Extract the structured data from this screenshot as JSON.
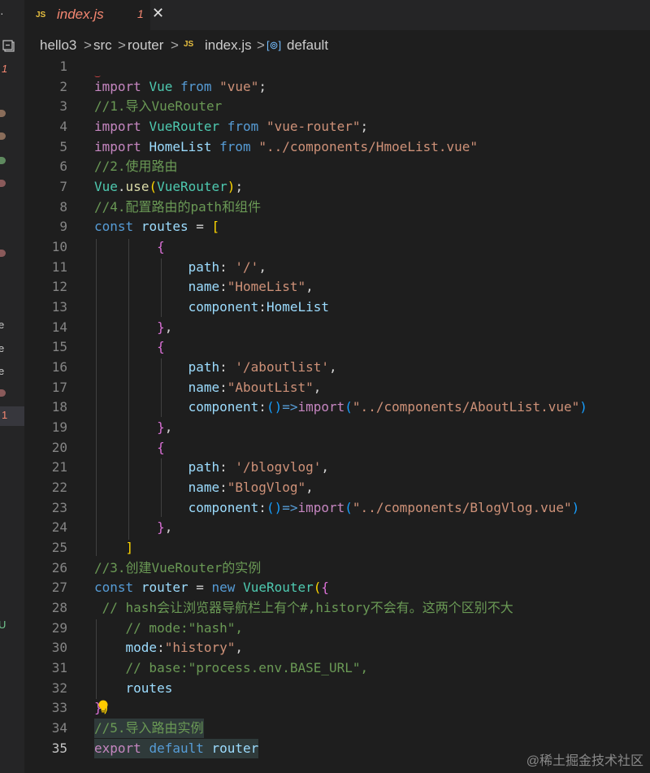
{
  "tab": {
    "icon_label": "JS",
    "filename": "index.js",
    "problem_count": "1",
    "close_glyph": "✕",
    "modified_color": "#f48771"
  },
  "edge_markers": {
    "top": "·",
    "badge_1": "1",
    "letter_e1": "e",
    "letter_e2": "e",
    "letter_e3": "e",
    "badge_2": "1",
    "letter_u": "U"
  },
  "breadcrumb": {
    "items": [
      "hello3",
      "src",
      "router",
      "index.js",
      "default"
    ],
    "separator": ">",
    "file_icon": "JS",
    "symbol_icon": "[⊚]"
  },
  "editor": {
    "active_line": 35,
    "line_numbers": [
      "1",
      "2",
      "3",
      "4",
      "5",
      "6",
      "7",
      "8",
      "9",
      "10",
      "11",
      "12",
      "13",
      "14",
      "15",
      "16",
      "17",
      "18",
      "19",
      "20",
      "21",
      "22",
      "23",
      "24",
      "25",
      "26",
      "27",
      "28",
      "29",
      "30",
      "31",
      "32",
      "33",
      "34",
      "35"
    ],
    "lines": [
      "",
      "import Vue from \"vue\";",
      "//1.导入VueRouter",
      "import VueRouter from \"vue-router\";",
      "import HomeList from \"../components/HmoeList.vue\"",
      "//2.使用路由",
      "Vue.use(VueRouter);",
      "//4.配置路由的path和组件",
      "const routes = [",
      "        {",
      "            path: '/',",
      "            name:\"HomeList\",",
      "            component:HomeList",
      "        },",
      "        {",
      "            path: '/aboutlist',",
      "            name:\"AboutList\",",
      "            component:()=>import(\"../components/AboutList.vue\")",
      "        },",
      "        {",
      "            path: '/blogvlog',",
      "            name:\"BlogVlog\",",
      "            component:()=>import(\"../components/BlogVlog.vue\")",
      "        },",
      "    ]",
      "//3.创建VueRouter的实例",
      "const router = new VueRouter({",
      " // hash会让浏览器导航栏上有个#,history不会有。这两个区别不大",
      "    // mode:\"hash\",",
      "    mode:\"history\",",
      "    // base:\"process.env.BASE_URL\",",
      "    routes",
      "})",
      "//5.导入路由实例",
      "export default router"
    ]
  },
  "watermark": "@稀土掘金技术社区",
  "colors": {
    "background": "#1e1e1e",
    "keyword": "#569cd6",
    "control_keyword": "#c586c0",
    "string": "#ce9178",
    "comment": "#6a9955",
    "variable": "#9cdcfe",
    "class": "#4ec9b0",
    "function": "#dcdcaa",
    "error": "#f14c4c"
  }
}
